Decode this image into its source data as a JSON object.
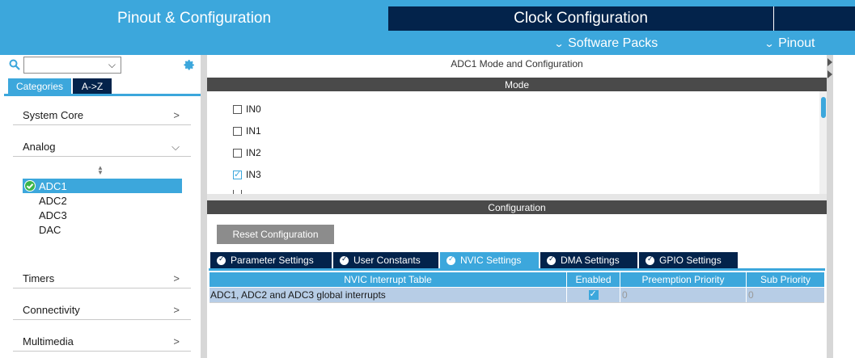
{
  "header": {
    "tabs": [
      {
        "label": "Pinout & Configuration"
      },
      {
        "label": "Clock Configuration"
      }
    ],
    "menus": {
      "software_packs": "Software Packs",
      "pinout": "Pinout"
    }
  },
  "sidebar": {
    "tabs": {
      "categories": "Categories",
      "atoz": "A->Z"
    },
    "categories": [
      {
        "label": "System Core"
      },
      {
        "label": "Analog"
      },
      {
        "label": "Timers"
      },
      {
        "label": "Connectivity"
      },
      {
        "label": "Multimedia"
      }
    ],
    "analog_items": [
      {
        "label": "ADC1",
        "selected": true
      },
      {
        "label": "ADC2"
      },
      {
        "label": "ADC3"
      },
      {
        "label": "DAC"
      }
    ]
  },
  "main": {
    "title": "ADC1 Mode and Configuration",
    "mode_header": "Mode",
    "mode_inputs": [
      {
        "label": "IN0",
        "checked": false
      },
      {
        "label": "IN1",
        "checked": false
      },
      {
        "label": "IN2",
        "checked": false
      },
      {
        "label": "IN3",
        "checked": true
      }
    ],
    "config_header": "Configuration",
    "reset_label": "Reset Configuration",
    "config_tabs": [
      {
        "label": "Parameter Settings"
      },
      {
        "label": "User Constants"
      },
      {
        "label": "NVIC Settings",
        "active": true
      },
      {
        "label": "DMA Settings"
      },
      {
        "label": "GPIO Settings"
      }
    ],
    "nvic_table": {
      "columns": [
        "NVIC Interrupt Table",
        "Enabled",
        "Preemption Priority",
        "Sub Priority"
      ],
      "rows": [
        {
          "name": "ADC1, ADC2 and ADC3 global interrupts",
          "enabled": true,
          "preemption": "0",
          "sub": "0"
        }
      ]
    }
  },
  "colors": {
    "accent": "#3ca7dc",
    "navy": "#03234b",
    "dark_bar": "#4a4a4a",
    "row_bg": "#b7cde6"
  }
}
